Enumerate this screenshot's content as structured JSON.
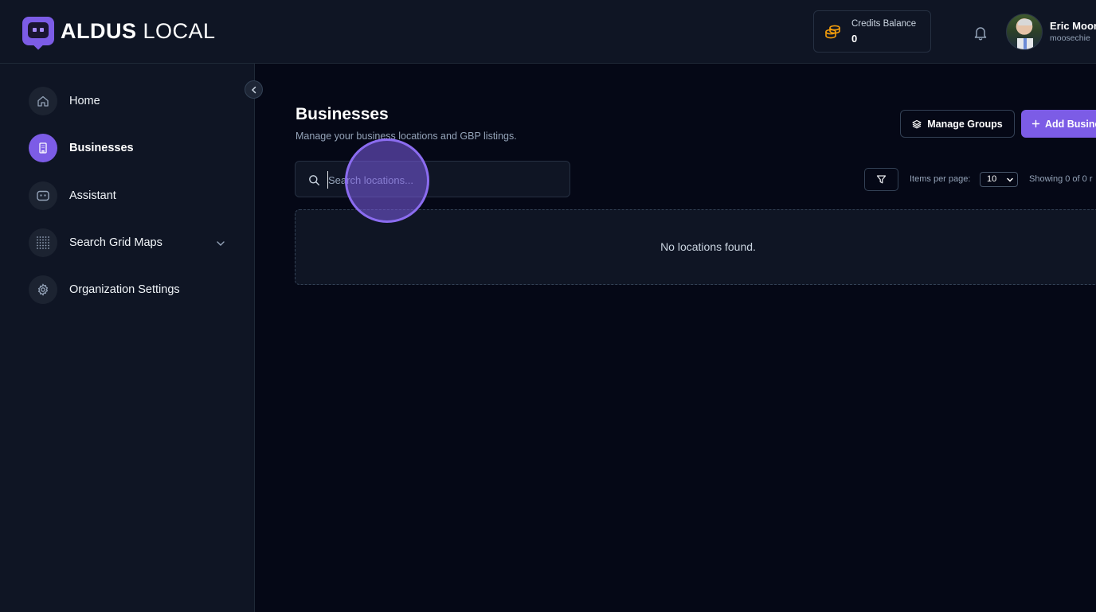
{
  "brand": {
    "name_bold": "ALDUS",
    "name_light": "LOCAL"
  },
  "credits": {
    "label": "Credits Balance",
    "value": "0"
  },
  "user": {
    "name": "Eric Moor",
    "email": "moosechie"
  },
  "sidebar": {
    "items": [
      {
        "label": "Home",
        "icon": "home-icon",
        "active": false
      },
      {
        "label": "Businesses",
        "icon": "building-icon",
        "active": true
      },
      {
        "label": "Assistant",
        "icon": "assistant-icon",
        "active": false
      },
      {
        "label": "Search Grid Maps",
        "icon": "grid-icon",
        "active": false,
        "expandable": true
      },
      {
        "label": "Organization Settings",
        "icon": "gear-icon",
        "active": false
      }
    ]
  },
  "page": {
    "title": "Businesses",
    "subtitle": "Manage your business locations and GBP listings.",
    "manage_groups_label": "Manage Groups",
    "add_business_label": "Add Busine"
  },
  "search": {
    "placeholder": "Search locations...",
    "value": ""
  },
  "pagination": {
    "items_per_page_label": "Items per page:",
    "items_per_page_value": "10",
    "showing_text": "Showing 0 of 0 r"
  },
  "empty_state": {
    "text": "No locations found."
  },
  "colors": {
    "accent": "#7c5ce6",
    "background": "#050816",
    "panel": "#0f1524",
    "coin": "#f59e0b"
  }
}
